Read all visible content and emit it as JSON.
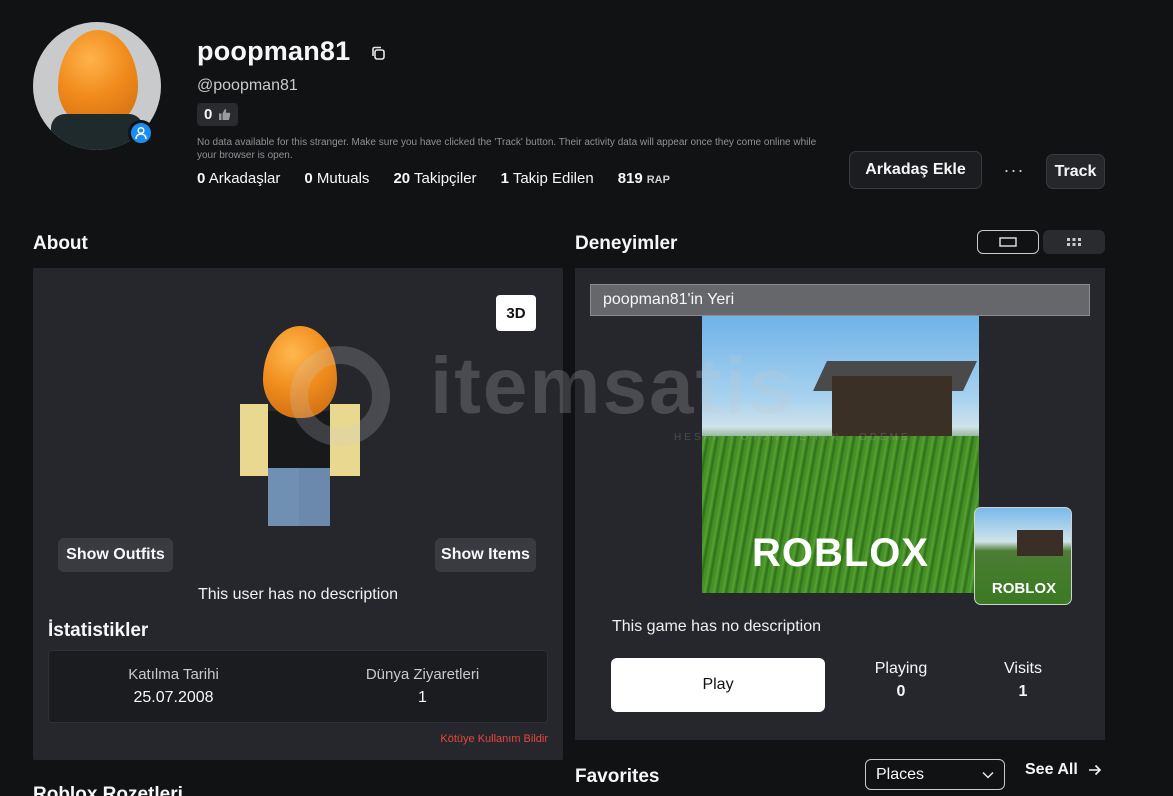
{
  "profile": {
    "display_name": "poopman81",
    "handle": "@poopman81",
    "likes": "0",
    "notice": "No data available for this stranger. Make sure you have clicked the 'Track' button. Their activity data will appear once they come online while your browser is open.",
    "stats": {
      "friends_count": "0",
      "friends_label": "Arkadaşlar",
      "mutuals_count": "0",
      "mutuals_label": "Mutuals",
      "followers_count": "20",
      "followers_label": "Takipçiler",
      "following_count": "1",
      "following_label": "Takip Edilen",
      "rap_value": "819",
      "rap_label": "RAP"
    },
    "add_friend_label": "Arkadaş Ekle",
    "more_label": "···",
    "track_label": "Track"
  },
  "about": {
    "title": "About",
    "view_3d_label": "3D",
    "show_outfits_label": "Show Outfits",
    "show_items_label": "Show Items",
    "description": "This user has no description",
    "stats_title": "İstatistikler",
    "join_date_label": "Katılma Tarihi",
    "join_date_value": "25.07.2008",
    "place_visits_label": "Dünya Ziyaretleri",
    "place_visits_value": "1",
    "report_label": "Kötüye Kullanım Bildir"
  },
  "experiences": {
    "title": "Deneyimler",
    "game_title": "poopman81'in Yeri",
    "thumb_logo": "ROBLOX",
    "mini_logo": "ROBLOX",
    "description": "This game has no description",
    "play_label": "Play",
    "playing_label": "Playing",
    "playing_value": "0",
    "visits_label": "Visits",
    "visits_value": "1"
  },
  "favorites": {
    "title": "Favorites",
    "selected": "Places",
    "see_all_label": "See All"
  },
  "badges": {
    "title": "Roblox Rozetleri"
  },
  "watermark": {
    "text": "itemsatis",
    "subtext": "HESAP · OYUN · E-PIN · ODEME"
  },
  "colors": {
    "background": "#111214",
    "panel": "#25272c",
    "accent_blue": "#1a8ef0",
    "report_red": "#e8463b"
  }
}
